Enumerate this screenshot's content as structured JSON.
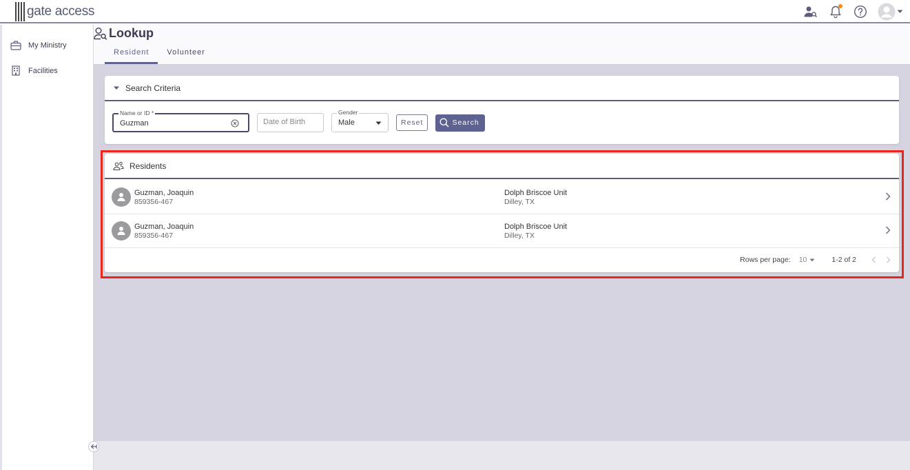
{
  "app": {
    "logo_text": "gate access"
  },
  "colors": {
    "accent": "#5e6290",
    "highlight": "#e8261b",
    "notification": "#f28a1e"
  },
  "topbar": {
    "icons": [
      "person-search-icon",
      "bell-icon",
      "help-icon",
      "user-avatar-icon"
    ]
  },
  "sidebar": {
    "items": [
      {
        "label": "My Ministry",
        "icon": "briefcase-icon"
      },
      {
        "label": "Facilities",
        "icon": "building-icon"
      }
    ]
  },
  "page": {
    "title": "Lookup",
    "tabs": [
      {
        "label": "Resident",
        "active": true
      },
      {
        "label": "Volunteer",
        "active": false
      }
    ]
  },
  "search": {
    "section_title": "Search Criteria",
    "name_label": "Name or ID *",
    "name_value": "Guzman",
    "dob_placeholder": "Date of Birth",
    "gender_label": "Gender",
    "gender_value": "Male",
    "reset_label": "Reset",
    "search_label": "Search"
  },
  "residents": {
    "section_title": "Residents",
    "rows": [
      {
        "name": "Guzman, Joaquin",
        "id": "859356-467",
        "facility": "Dolph Briscoe Unit",
        "location": "Dilley, TX"
      },
      {
        "name": "Guzman, Joaquin",
        "id": "859356-467",
        "facility": "Dolph Briscoe Unit",
        "location": "Dilley, TX"
      }
    ],
    "pager": {
      "rows_per_page_label": "Rows per page:",
      "rows_per_page_value": "10",
      "range": "1-2 of 2"
    }
  }
}
